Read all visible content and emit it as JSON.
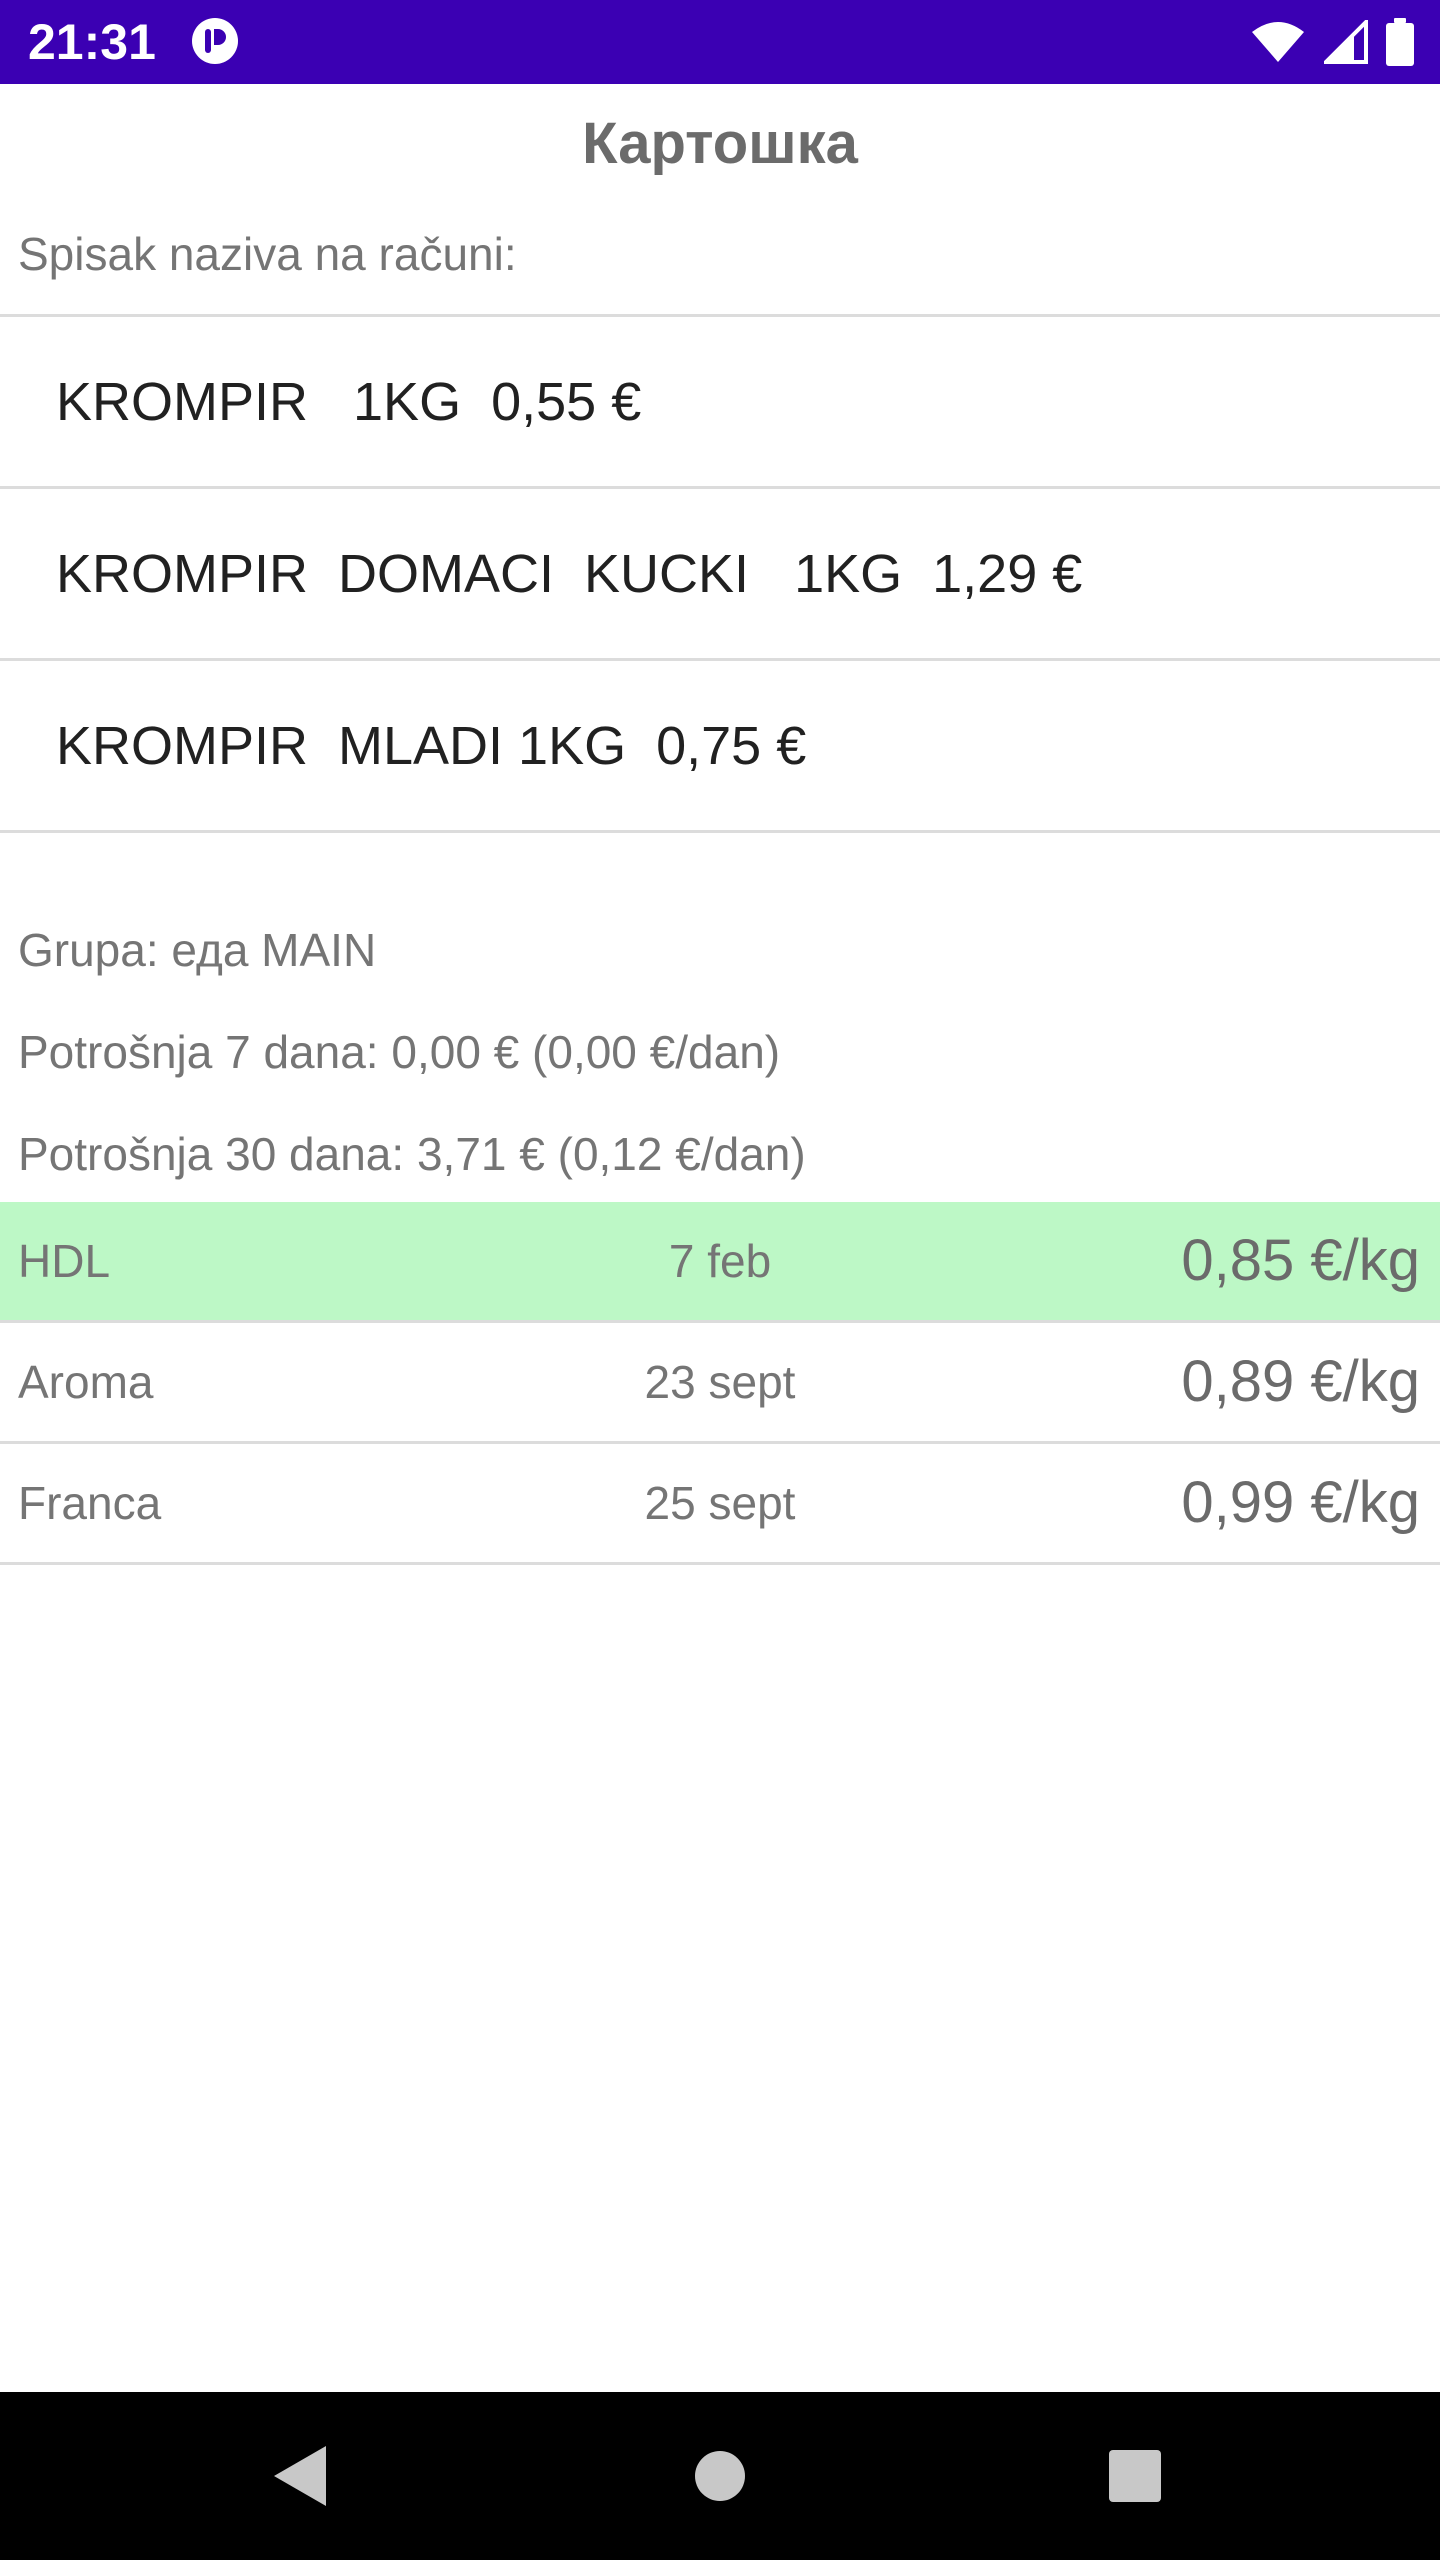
{
  "status_bar": {
    "time": "21:31",
    "icons": [
      "app-notification-icon",
      "wifi-icon",
      "cellular-signal-icon",
      "battery-icon"
    ]
  },
  "header": {
    "title": "Картошка"
  },
  "receipt_names": {
    "label": "Spisak naziva na računi:",
    "items": [
      "KROMPIR   1KG  0,55 €",
      "KROMPIR  DOMACI  KUCKI   1KG  1,29 €",
      "KROMPIR  MLADI 1KG  0,75 €"
    ]
  },
  "info": {
    "group": "Grupa: еда MAIN",
    "spend_7": "Potrošnja 7 dana: 0,00 € (0,00 €/dan)",
    "spend_30": "Potrošnja 30 dana: 3,71 € (0,12 €/dan)"
  },
  "prices": [
    {
      "store": "HDL",
      "date": "7 feb",
      "price": "0,85 €/kg",
      "highlighted": true
    },
    {
      "store": "Aroma",
      "date": "23 sept",
      "price": "0,89 €/kg",
      "highlighted": false
    },
    {
      "store": "Franca",
      "date": "25 sept",
      "price": "0,99 €/kg",
      "highlighted": false
    }
  ],
  "colors": {
    "status_bar": "#3b00b3",
    "highlight_row": "#bdf8c6",
    "divider": "#dcdcdc",
    "nav_bar": "#000000"
  },
  "nav": {
    "icons": [
      "back-icon",
      "home-icon",
      "recents-icon"
    ]
  }
}
